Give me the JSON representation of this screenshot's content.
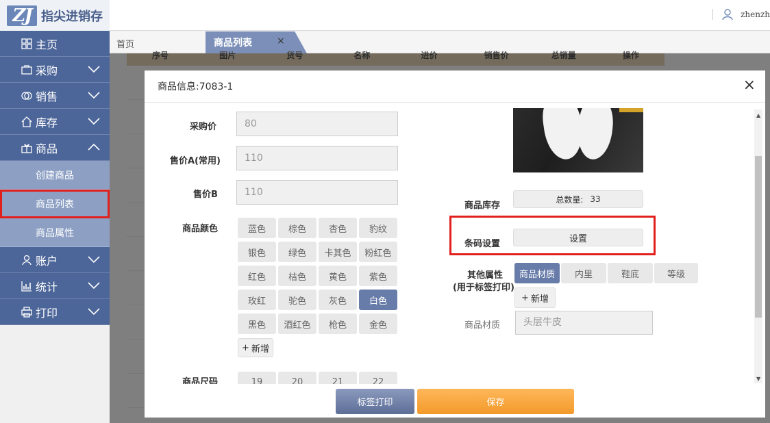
{
  "app": {
    "logo_mark": "ZJ",
    "logo_text": "指尖进销存",
    "username": "zhenzh"
  },
  "sidebar": {
    "items": [
      {
        "label": "主页"
      },
      {
        "label": "采购"
      },
      {
        "label": "销售"
      },
      {
        "label": "库存"
      },
      {
        "label": "商品"
      }
    ],
    "sub_items": [
      {
        "label": "创建商品"
      },
      {
        "label": "商品列表"
      },
      {
        "label": "商品属性"
      }
    ],
    "items_after": [
      {
        "label": "账户"
      },
      {
        "label": "统计"
      },
      {
        "label": "打印"
      }
    ]
  },
  "tabs": {
    "home": "首页",
    "active": "商品列表",
    "close": "×"
  },
  "table": {
    "headers": [
      "序号",
      "图片",
      "货号",
      "名称",
      "进价",
      "销售价",
      "总销量",
      "操作"
    ]
  },
  "modal": {
    "title": "商品信息:7083-1",
    "close": "×",
    "fields": {
      "purchase_price_label": "采购价",
      "purchase_price_value": "80",
      "price_a_label": "售价A(常用)",
      "price_a_value": "110",
      "price_b_label": "售价B",
      "price_b_value": "110",
      "color_label": "商品颜色",
      "size_label": "商品尺码"
    },
    "colors": [
      "蓝色",
      "棕色",
      "杏色",
      "豹纹",
      "银色",
      "绿色",
      "卡其色",
      "粉红色",
      "红色",
      "桔色",
      "黄色",
      "紫色",
      "玫红",
      "驼色",
      "灰色",
      "白色",
      "黑色",
      "酒红色",
      "枪色",
      "金色"
    ],
    "selected_color": "白色",
    "add_label": "新增",
    "sizes": [
      "19",
      "20",
      "21",
      "22"
    ],
    "stock_label": "商品库存",
    "stock_total_label": "总数量:",
    "stock_total_value": "33",
    "barcode_label": "条码设置",
    "barcode_button": "设置",
    "other_attr_label": "其他属性",
    "other_attr_sub": "(用于标签打印)",
    "attr_tabs": [
      "商品材质",
      "内里",
      "鞋底",
      "等级"
    ],
    "selected_attr": "商品材质",
    "material_label": "商品材质",
    "material_value": "头层牛皮",
    "print_button": "标签打印",
    "save_button": "保存"
  }
}
